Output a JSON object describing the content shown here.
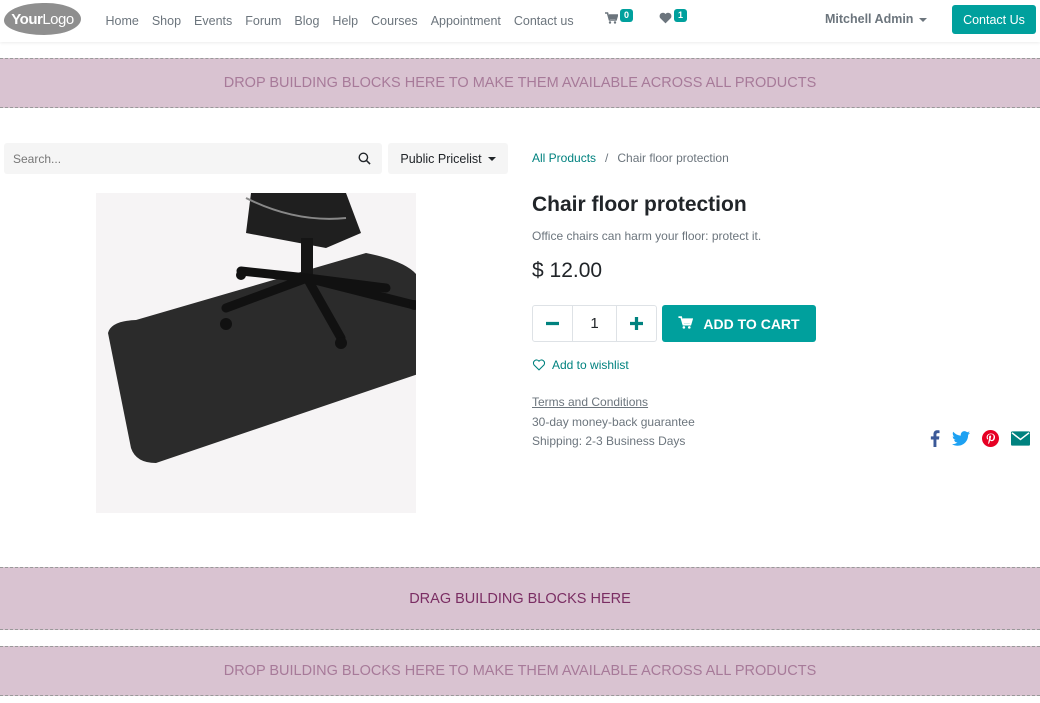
{
  "header": {
    "logo_text_bold": "Your",
    "logo_text": "Logo",
    "nav": [
      "Home",
      "Shop",
      "Events",
      "Forum",
      "Blog",
      "Help",
      "Courses",
      "Appointment",
      "Contact us"
    ],
    "cart_count": "0",
    "wishlist_count": "1",
    "user": "Mitchell Admin",
    "contact_button": "Contact Us"
  },
  "drop_zones": {
    "top": "DROP BUILDING BLOCKS HERE TO MAKE THEM AVAILABLE ACROSS ALL PRODUCTS",
    "middle": "DRAG BUILDING BLOCKS HERE",
    "bottom": "DROP BUILDING BLOCKS HERE TO MAKE THEM AVAILABLE ACROSS ALL PRODUCTS"
  },
  "search": {
    "placeholder": "Search...",
    "value": ""
  },
  "pricelist": {
    "selected": "Public Pricelist"
  },
  "breadcrumb": {
    "parent": "All Products",
    "separator": "/",
    "current": "Chair floor protection"
  },
  "product": {
    "name": "Chair floor protection",
    "description": "Office chairs can harm your floor: protect it.",
    "price": "$ 12.00",
    "quantity": "1",
    "add_to_cart": "ADD TO CART",
    "wishlist": "Add to wishlist",
    "terms": "Terms and Conditions",
    "guarantee": "30-day money-back guarantee",
    "shipping": "Shipping: 2-3 Business Days"
  },
  "colors": {
    "primary": "#00a09d",
    "link": "#00827f",
    "drop_zone_bg": "#d9c3d1",
    "facebook": "#3b5998",
    "twitter": "#1da1f2",
    "pinterest": "#e60023",
    "email": "#00827f"
  }
}
